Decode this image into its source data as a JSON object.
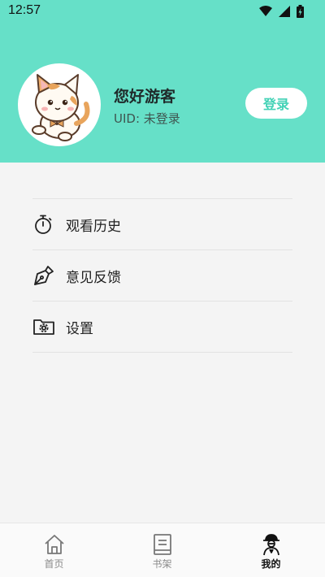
{
  "status_bar": {
    "time": "12:57"
  },
  "profile": {
    "name": "您好游客",
    "uid": "UID: 未登录",
    "login_label": "登录"
  },
  "menu": [
    {
      "label": "观看历史",
      "icon": "stopwatch-icon"
    },
    {
      "label": "意见反馈",
      "icon": "pen-icon"
    },
    {
      "label": "设置",
      "icon": "settings-folder-icon"
    }
  ],
  "tabs": [
    {
      "label": "首页",
      "icon": "home-icon",
      "active": false
    },
    {
      "label": "书架",
      "icon": "bookshelf-icon",
      "active": false
    },
    {
      "label": "我的",
      "icon": "profile-icon",
      "active": true
    }
  ],
  "colors": {
    "header": "#66e0c8",
    "accent": "#43d2b6",
    "background": "#f4f4f4"
  }
}
